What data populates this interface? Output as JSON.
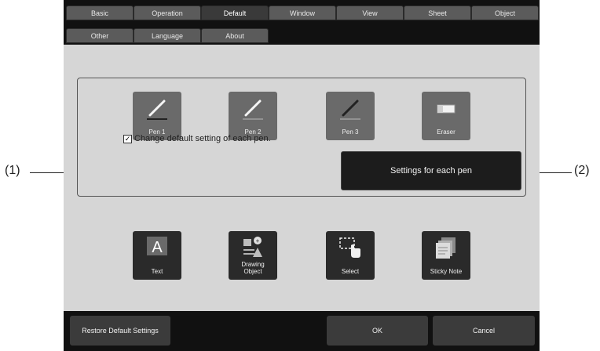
{
  "tabs_row1": [
    "Basic",
    "Operation",
    "Default",
    "Window",
    "View",
    "Sheet",
    "Object"
  ],
  "tabs_row2": [
    "Other",
    "Language",
    "About"
  ],
  "active_tab": "Default",
  "pens": [
    {
      "label": "Pen 1",
      "icon": "pen-icon"
    },
    {
      "label": "Pen 2",
      "icon": "pen-icon"
    },
    {
      "label": "Pen 3",
      "icon": "pen-icon"
    },
    {
      "label": "Eraser",
      "icon": "eraser-icon"
    }
  ],
  "checkbox_label": "Change default setting of each pen.",
  "checkbox_checked": true,
  "settings_button": "Settings for each pen",
  "tools": [
    {
      "label": "Text",
      "icon": "text-icon"
    },
    {
      "label": "Drawing\nObject",
      "icon": "drawing-object-icon"
    },
    {
      "label": "Select",
      "icon": "select-icon"
    },
    {
      "label": "Sticky Note",
      "icon": "sticky-note-icon"
    }
  ],
  "footer": {
    "restore": "Restore Default Settings",
    "ok": "OK",
    "cancel": "Cancel"
  },
  "callouts": {
    "left": "(1)",
    "right": "(2)"
  }
}
